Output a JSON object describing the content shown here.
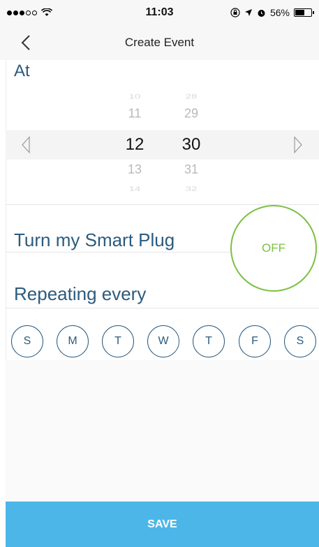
{
  "status_bar": {
    "time": "11:03",
    "battery_percent": "56%",
    "battery_level": 0.56,
    "icons": [
      "signal-dots-icon",
      "wifi-icon",
      "screen-lock-icon",
      "location-arrow-icon",
      "alarm-icon",
      "battery-icon"
    ]
  },
  "nav": {
    "title": "Create Event",
    "back_icon": "chevron-left-icon"
  },
  "at_section": {
    "title": "At"
  },
  "time_picker": {
    "hours": [
      "10",
      "11",
      "12",
      "13",
      "14"
    ],
    "minutes": [
      "28",
      "29",
      "30",
      "31",
      "32"
    ],
    "selected_hour": "12",
    "selected_minute": "30",
    "left_arrow_icon": "triangle-left-icon",
    "right_arrow_icon": "triangle-right-icon"
  },
  "plug_section": {
    "title": "Turn my Smart Plug",
    "toggle_label": "OFF",
    "accent": "#7bc142"
  },
  "repeat_section": {
    "title": "Repeating every",
    "days": [
      "S",
      "M",
      "T",
      "W",
      "T",
      "F",
      "S"
    ]
  },
  "footer": {
    "save_label": "SAVE",
    "color": "#4db6e8"
  },
  "colors": {
    "text_blue": "#2c5b7e",
    "green": "#7bc142",
    "save_blue": "#4db6e8"
  }
}
